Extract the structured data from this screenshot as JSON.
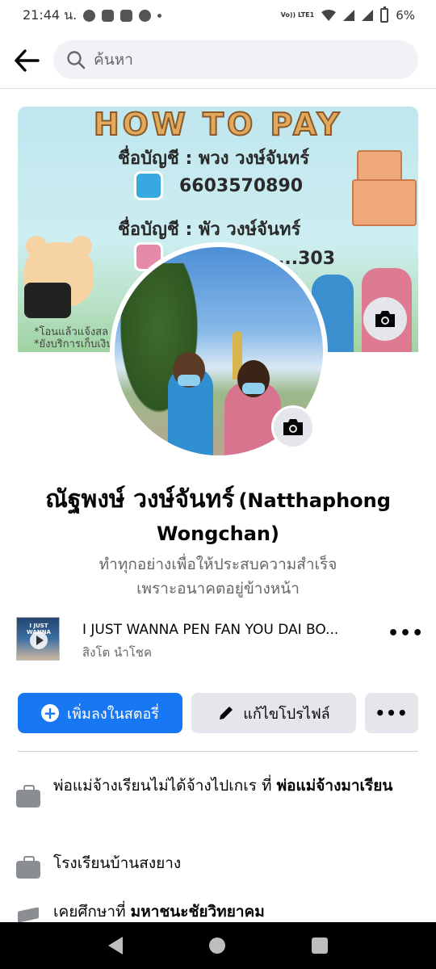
{
  "status_bar": {
    "time": "21:44 น.",
    "volte_label": "Vo)) LTE1",
    "battery": "6%"
  },
  "search": {
    "placeholder": "ค้นหา"
  },
  "cover": {
    "title": "HOW TO PAY",
    "account_line_1": "ชื่อบัญชี : พวง วงษ์จันทร์",
    "account_number_1": "6603570890",
    "account_line_2": "ชื่อบัญชี : พัว วงษ์จันทร์",
    "account_number_2_partial": "...303",
    "note_1": "*โอนแล้วแจ้งสล",
    "note_2": "*ยังบริการเก็บเงิน"
  },
  "profile": {
    "name_main": "ณัฐพงษ์ วงษ์จันทร์",
    "name_alt": "(Natthaphong Wongchan)",
    "bio_line_1": "ทำทุกอย่างเพื่อให้ประสบความสำเร็จ",
    "bio_line_2": "เพราะอนาคตอยู่ข้างหน้า"
  },
  "music": {
    "album_text": "I JUST WANNA",
    "title": "I JUST WANNA PEN FAN YOU DAI BO...",
    "artist": "สิงโต นำโชค",
    "more_label": "•••"
  },
  "actions": {
    "add_story": "เพิ่มลงในสตอรี่",
    "edit_profile": "แก้ไขโปรไฟล์",
    "more": "•••"
  },
  "details": [
    {
      "icon": "briefcase-icon",
      "prefix": "พ่อแม่จ้างเรียนไม่ได้จ้างไปเกเร ที่ ",
      "bold": "พ่อแม่จ้างมาเรียน"
    },
    {
      "icon": "briefcase-icon",
      "prefix": "โรงเรียนบ้านสงยาง",
      "bold": ""
    },
    {
      "icon": "graduation-cap-icon",
      "prefix": "เคยศึกษาที่ ",
      "bold": "มหาชนะชัยวิทยาคม"
    }
  ],
  "colors": {
    "primary": "#1877f2",
    "secondary_button": "#e4e6eb",
    "muted_text": "#65676b"
  }
}
